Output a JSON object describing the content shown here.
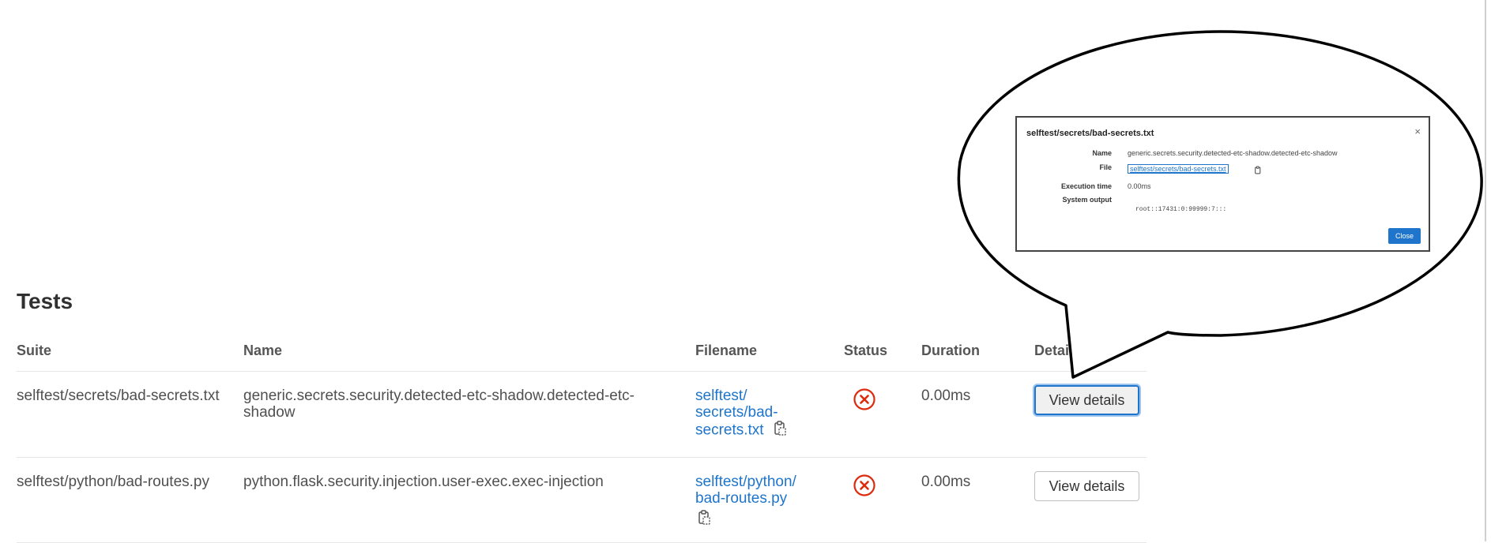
{
  "section": {
    "title": "Tests"
  },
  "table": {
    "headers": {
      "suite": "Suite",
      "name": "Name",
      "filename": "Filename",
      "status": "Status",
      "duration": "Duration",
      "details": "Details"
    },
    "rows": [
      {
        "suite": "selftest/secrets/bad-secrets.txt",
        "name": "generic.secrets.security.detected-etc-shadow.detected-etc-shadow",
        "filename_lines": [
          "selftest/",
          "secrets/bad-",
          "secrets.txt"
        ],
        "status_icon": "failed-x-circle-icon",
        "duration": "0.00ms",
        "details_label": "View details"
      },
      {
        "suite": "selftest/python/bad-routes.py",
        "name": "python.flask.security.injection.user-exec.exec-injection",
        "filename_lines": [
          "selftest/python/",
          "bad-routes.py"
        ],
        "status_icon": "failed-x-circle-icon",
        "duration": "0.00ms",
        "details_label": "View details"
      }
    ]
  },
  "modal_preview": {
    "title": "selftest/secrets/bad-secrets.txt",
    "close_glyph": "×",
    "name_label": "Name",
    "name_value": "generic.secrets.security.detected-etc-shadow.detected-etc-shadow",
    "file_label": "File",
    "file_value": "selftest/secrets/bad-secrets.txt",
    "execution_time_label": "Execution time",
    "execution_time_value": "0.00ms",
    "system_output_label": "System output",
    "system_output_value": "root::17431:0:99999:7:::",
    "close_button_label": "Close"
  },
  "colors": {
    "link": "#1f75cb",
    "failed": "#dd2b0e",
    "text": "#303030"
  }
}
